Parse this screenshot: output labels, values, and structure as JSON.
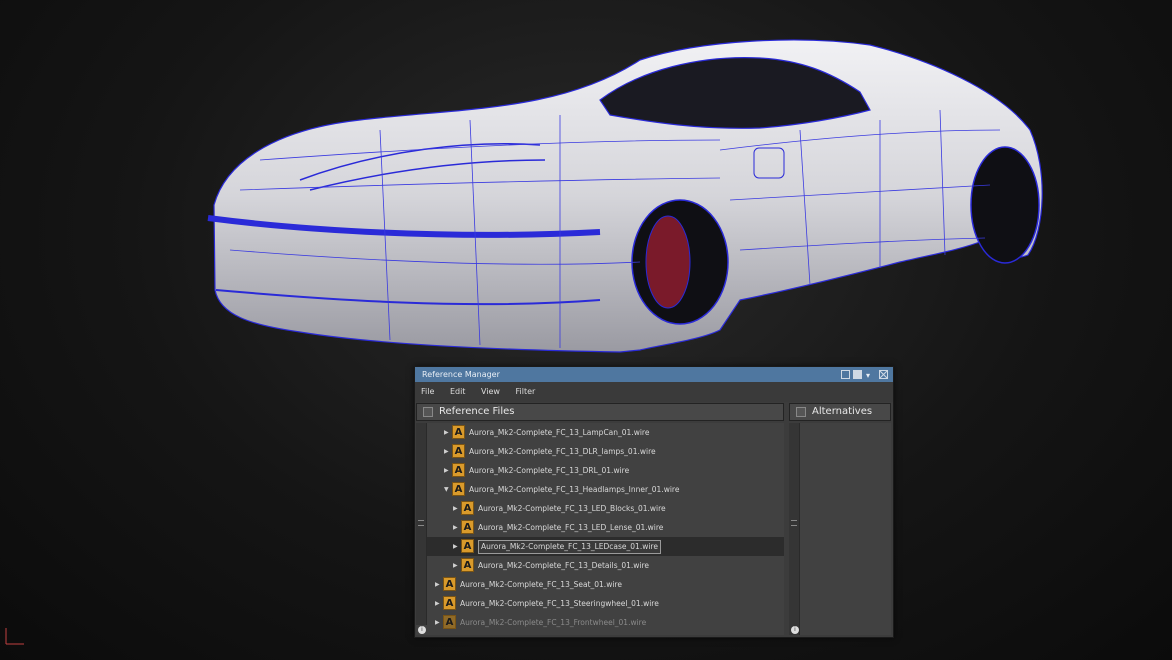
{
  "window": {
    "title": "Reference Manager",
    "menu": [
      "File",
      "Edit",
      "View",
      "Filter"
    ]
  },
  "panes": {
    "left_header": "Reference Files",
    "right_header": "Alternatives"
  },
  "files": [
    {
      "name": "Aurora_Mk2-Complete_FC_13_LampCan_01.wire",
      "level": 1,
      "expanded": false,
      "selected": false,
      "faded": false
    },
    {
      "name": "Aurora_Mk2-Complete_FC_13_DLR_lamps_01.wire",
      "level": 1,
      "expanded": false,
      "selected": false,
      "faded": false
    },
    {
      "name": "Aurora_Mk2-Complete_FC_13_DRL_01.wire",
      "level": 1,
      "expanded": false,
      "selected": false,
      "faded": false
    },
    {
      "name": "Aurora_Mk2-Complete_FC_13_Headlamps_Inner_01.wire",
      "level": 1,
      "expanded": true,
      "selected": false,
      "faded": false
    },
    {
      "name": "Aurora_Mk2-Complete_FC_13_LED_Blocks_01.wire",
      "level": 2,
      "expanded": false,
      "selected": false,
      "faded": false
    },
    {
      "name": "Aurora_Mk2-Complete_FC_13_LED_Lense_01.wire",
      "level": 2,
      "expanded": false,
      "selected": false,
      "faded": false
    },
    {
      "name": "Aurora_Mk2-Complete_FC_13_LEDcase_01.wire",
      "level": 2,
      "expanded": false,
      "selected": true,
      "faded": false
    },
    {
      "name": "Aurora_Mk2-Complete_FC_13_Details_01.wire",
      "level": 2,
      "expanded": false,
      "selected": false,
      "faded": false
    },
    {
      "name": "Aurora_Mk2-Complete_FC_13_Seat_01.wire",
      "level": 0,
      "expanded": false,
      "selected": false,
      "faded": false
    },
    {
      "name": "Aurora_Mk2-Complete_FC_13_Steeringwheel_01.wire",
      "level": 0,
      "expanded": false,
      "selected": false,
      "faded": false
    },
    {
      "name": "Aurora_Mk2-Complete_FC_13_Frontwheel_01.wire",
      "level": 0,
      "expanded": false,
      "selected": false,
      "faded": true
    }
  ],
  "icons": {
    "file": "alias-wire-file-icon",
    "expand": "triangle-right-icon",
    "collapse": "triangle-down-icon",
    "info": "info-icon"
  },
  "colors": {
    "title_bar": "#4f77a0",
    "wireframe": "#2a2ad8",
    "file_icon": "#d99a2b",
    "background": "#151515"
  }
}
